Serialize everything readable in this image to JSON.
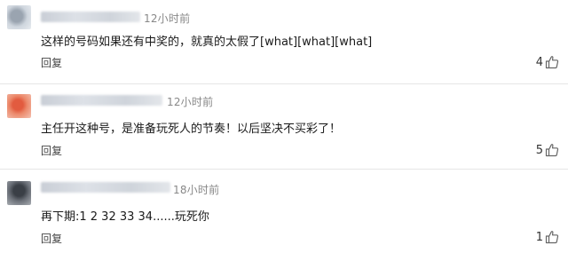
{
  "comments": [
    {
      "time": "12小时前",
      "text": "这样的号码如果还有中奖的，就真的太假了[what][what][what]",
      "reply_label": "回复",
      "likes": "4"
    },
    {
      "time": "12小时前",
      "text": "主任开这种号，是准备玩死人的节奏！以后坚决不买彩了！",
      "reply_label": "回复",
      "likes": "5"
    },
    {
      "time": "18小时前",
      "text": "再下期:1 2 32 33 34......玩死你",
      "reply_label": "回复",
      "likes": "1"
    }
  ],
  "icons": {
    "like": "thumbs-up-icon"
  },
  "colors": {
    "text": "#1a1a1a",
    "meta": "#888888",
    "divider": "#e6e6e6"
  }
}
